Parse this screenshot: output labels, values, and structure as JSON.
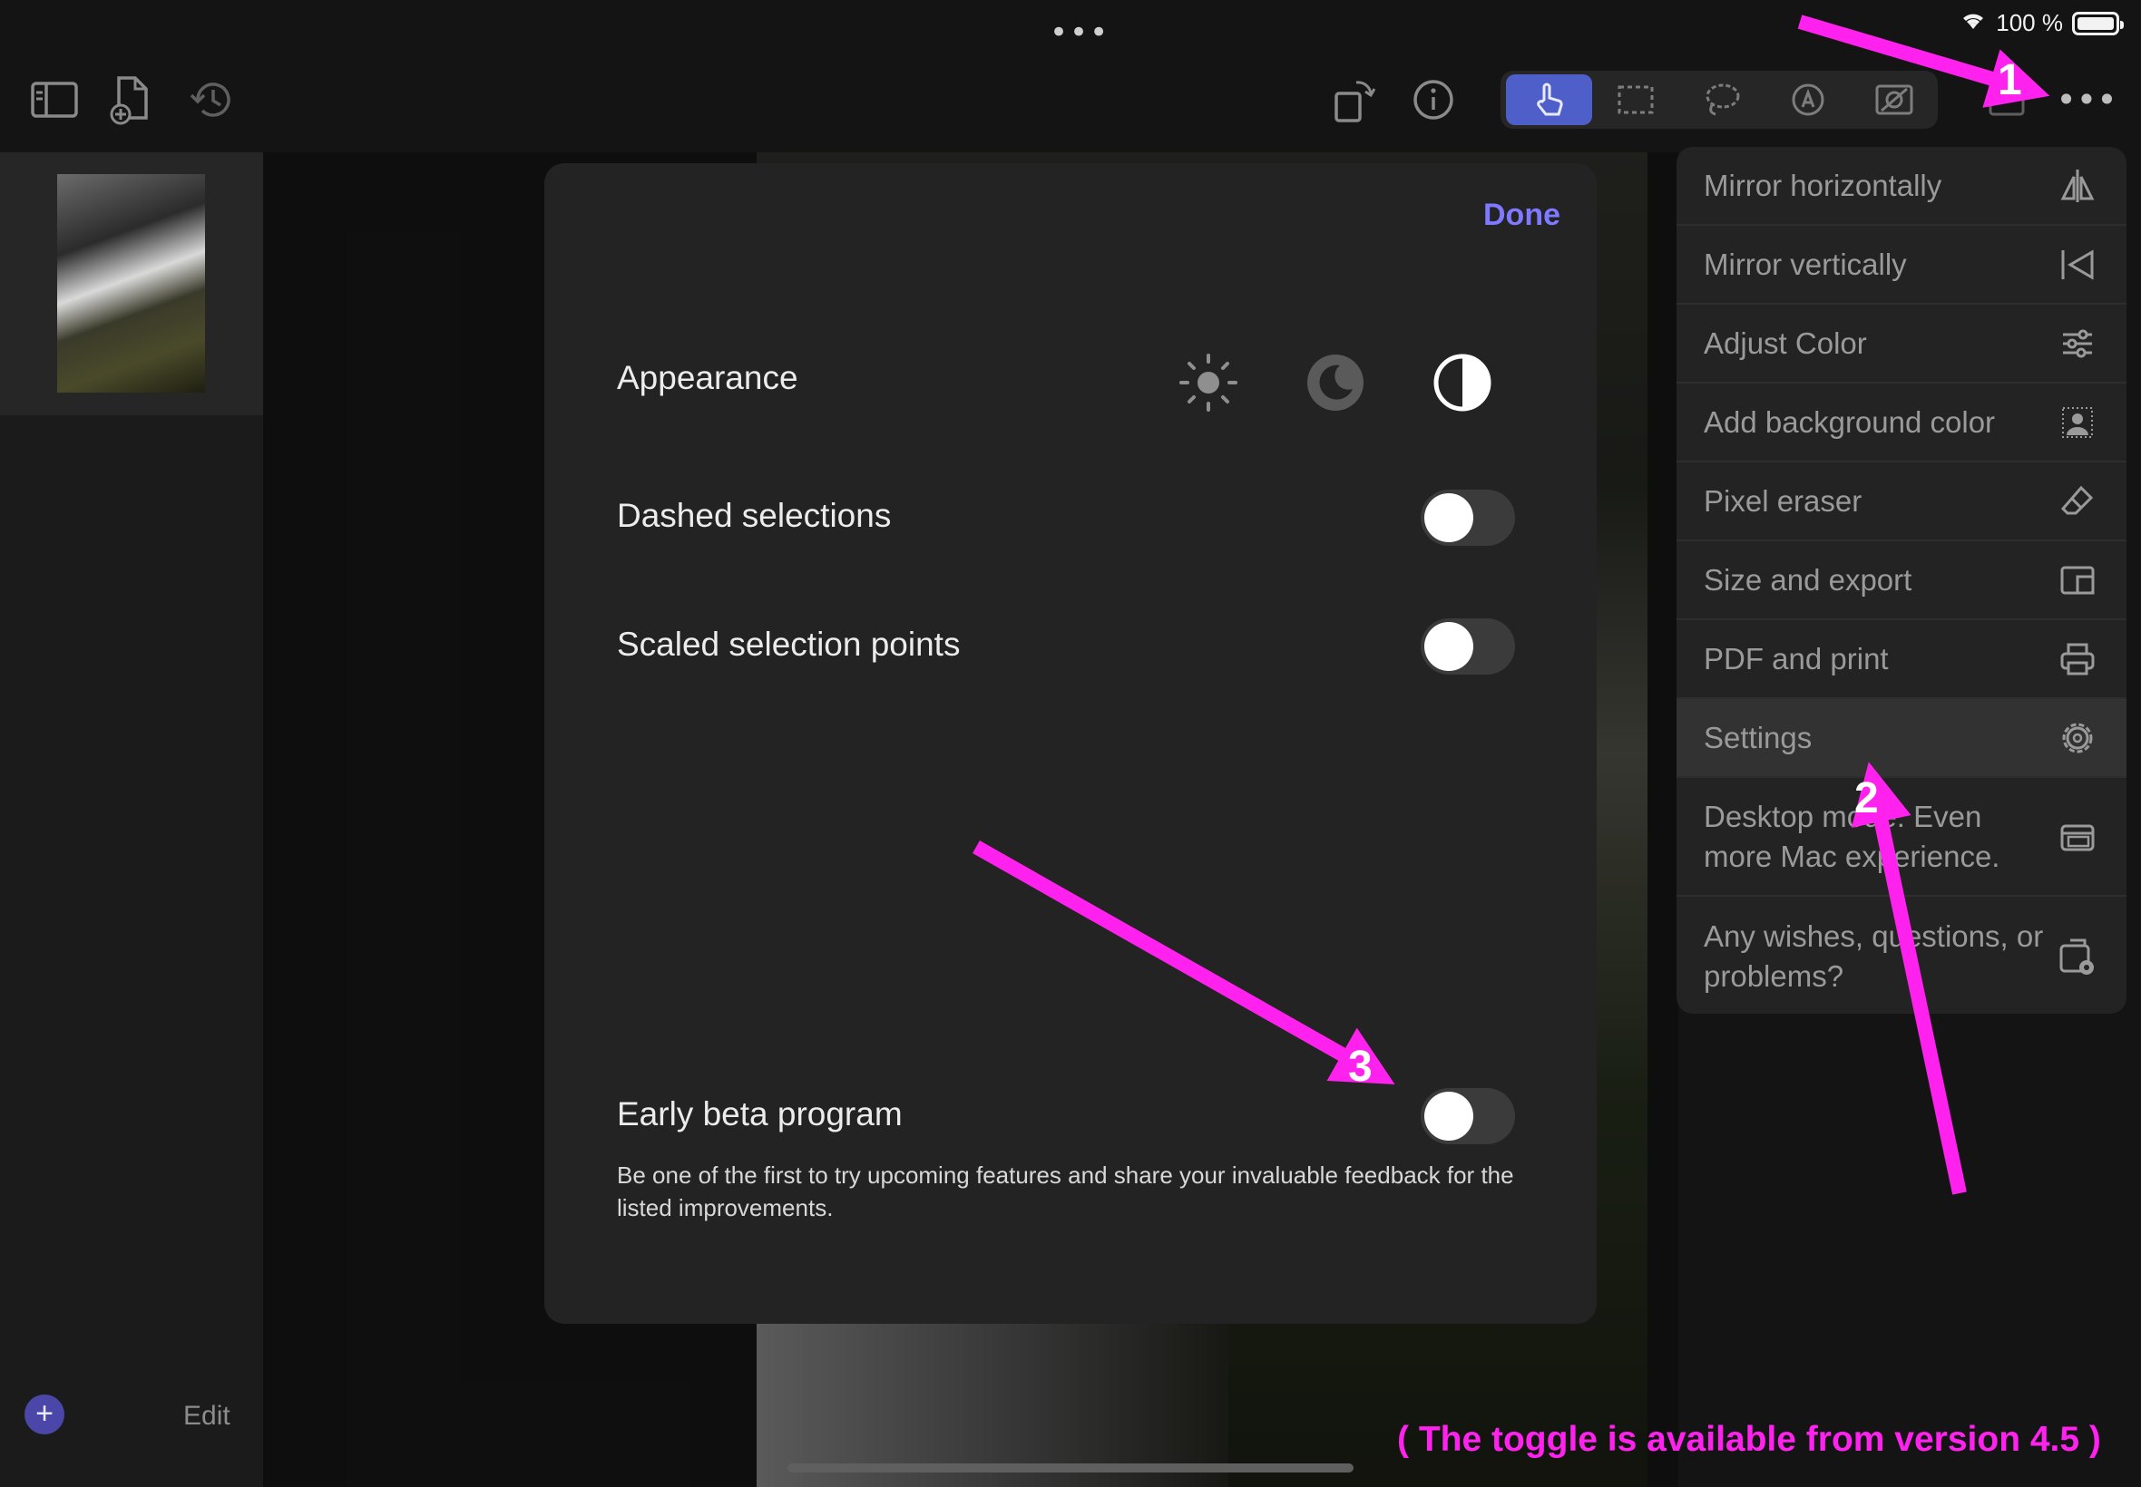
{
  "status_bar": {
    "center_dots": "•••",
    "battery_text": "100 %",
    "icons": [
      "wifi-icon",
      "battery-icon"
    ]
  },
  "toolbar": {
    "left_icons": [
      "sidebar-toggle-icon",
      "new-document-icon",
      "history-icon"
    ],
    "right_icons": [
      "rotate-icon",
      "info-icon"
    ],
    "tools": [
      "touch-tool-icon",
      "rect-select-icon",
      "lasso-icon",
      "markup-icon",
      "image-adjust-icon"
    ],
    "active_tool": "touch-tool-icon",
    "more_label": "•••",
    "accent": "#4e5fc9"
  },
  "sidebar": {
    "add_label": "+",
    "edit_label": "Edit"
  },
  "settings": {
    "done_label": "Done",
    "appearance_label": "Appearance",
    "appearance_options": [
      "light-mode-icon",
      "dark-mode-icon",
      "auto-mode-icon"
    ],
    "appearance_selected": "auto-mode-icon",
    "dashed_selections_label": "Dashed selections",
    "dashed_selections_on": false,
    "scaled_points_label": "Scaled selection points",
    "scaled_points_on": false,
    "beta_label": "Early beta program",
    "beta_on": false,
    "beta_description": "Be one of the first to try upcoming features and share your invaluable feedback for the listed improvements.",
    "done_color": "#7e79ff"
  },
  "menu": {
    "items": [
      {
        "label": "Mirror horizontally",
        "icon": "mirror-horizontal-icon"
      },
      {
        "label": "Mirror vertically",
        "icon": "mirror-vertical-icon"
      },
      {
        "label": "Adjust Color",
        "icon": "sliders-icon"
      },
      {
        "label": "Add background color",
        "icon": "background-person-icon"
      },
      {
        "label": "Pixel eraser",
        "icon": "eraser-icon"
      },
      {
        "label": "Size and export",
        "icon": "resize-icon"
      },
      {
        "label": "PDF and print",
        "icon": "printer-icon"
      },
      {
        "label": "Settings",
        "icon": "gear-icon"
      },
      {
        "label": "Desktop mode: Even more Mac experience.",
        "icon": "desktop-window-icon"
      },
      {
        "label": "Any wishes, questions, or problems?",
        "icon": "feedback-icon"
      }
    ],
    "selected": "Settings"
  },
  "annotations": {
    "color": "#ff22ee",
    "labels": [
      "1",
      "2",
      "3"
    ],
    "note": "( The toggle is available from version 4.5 )"
  }
}
